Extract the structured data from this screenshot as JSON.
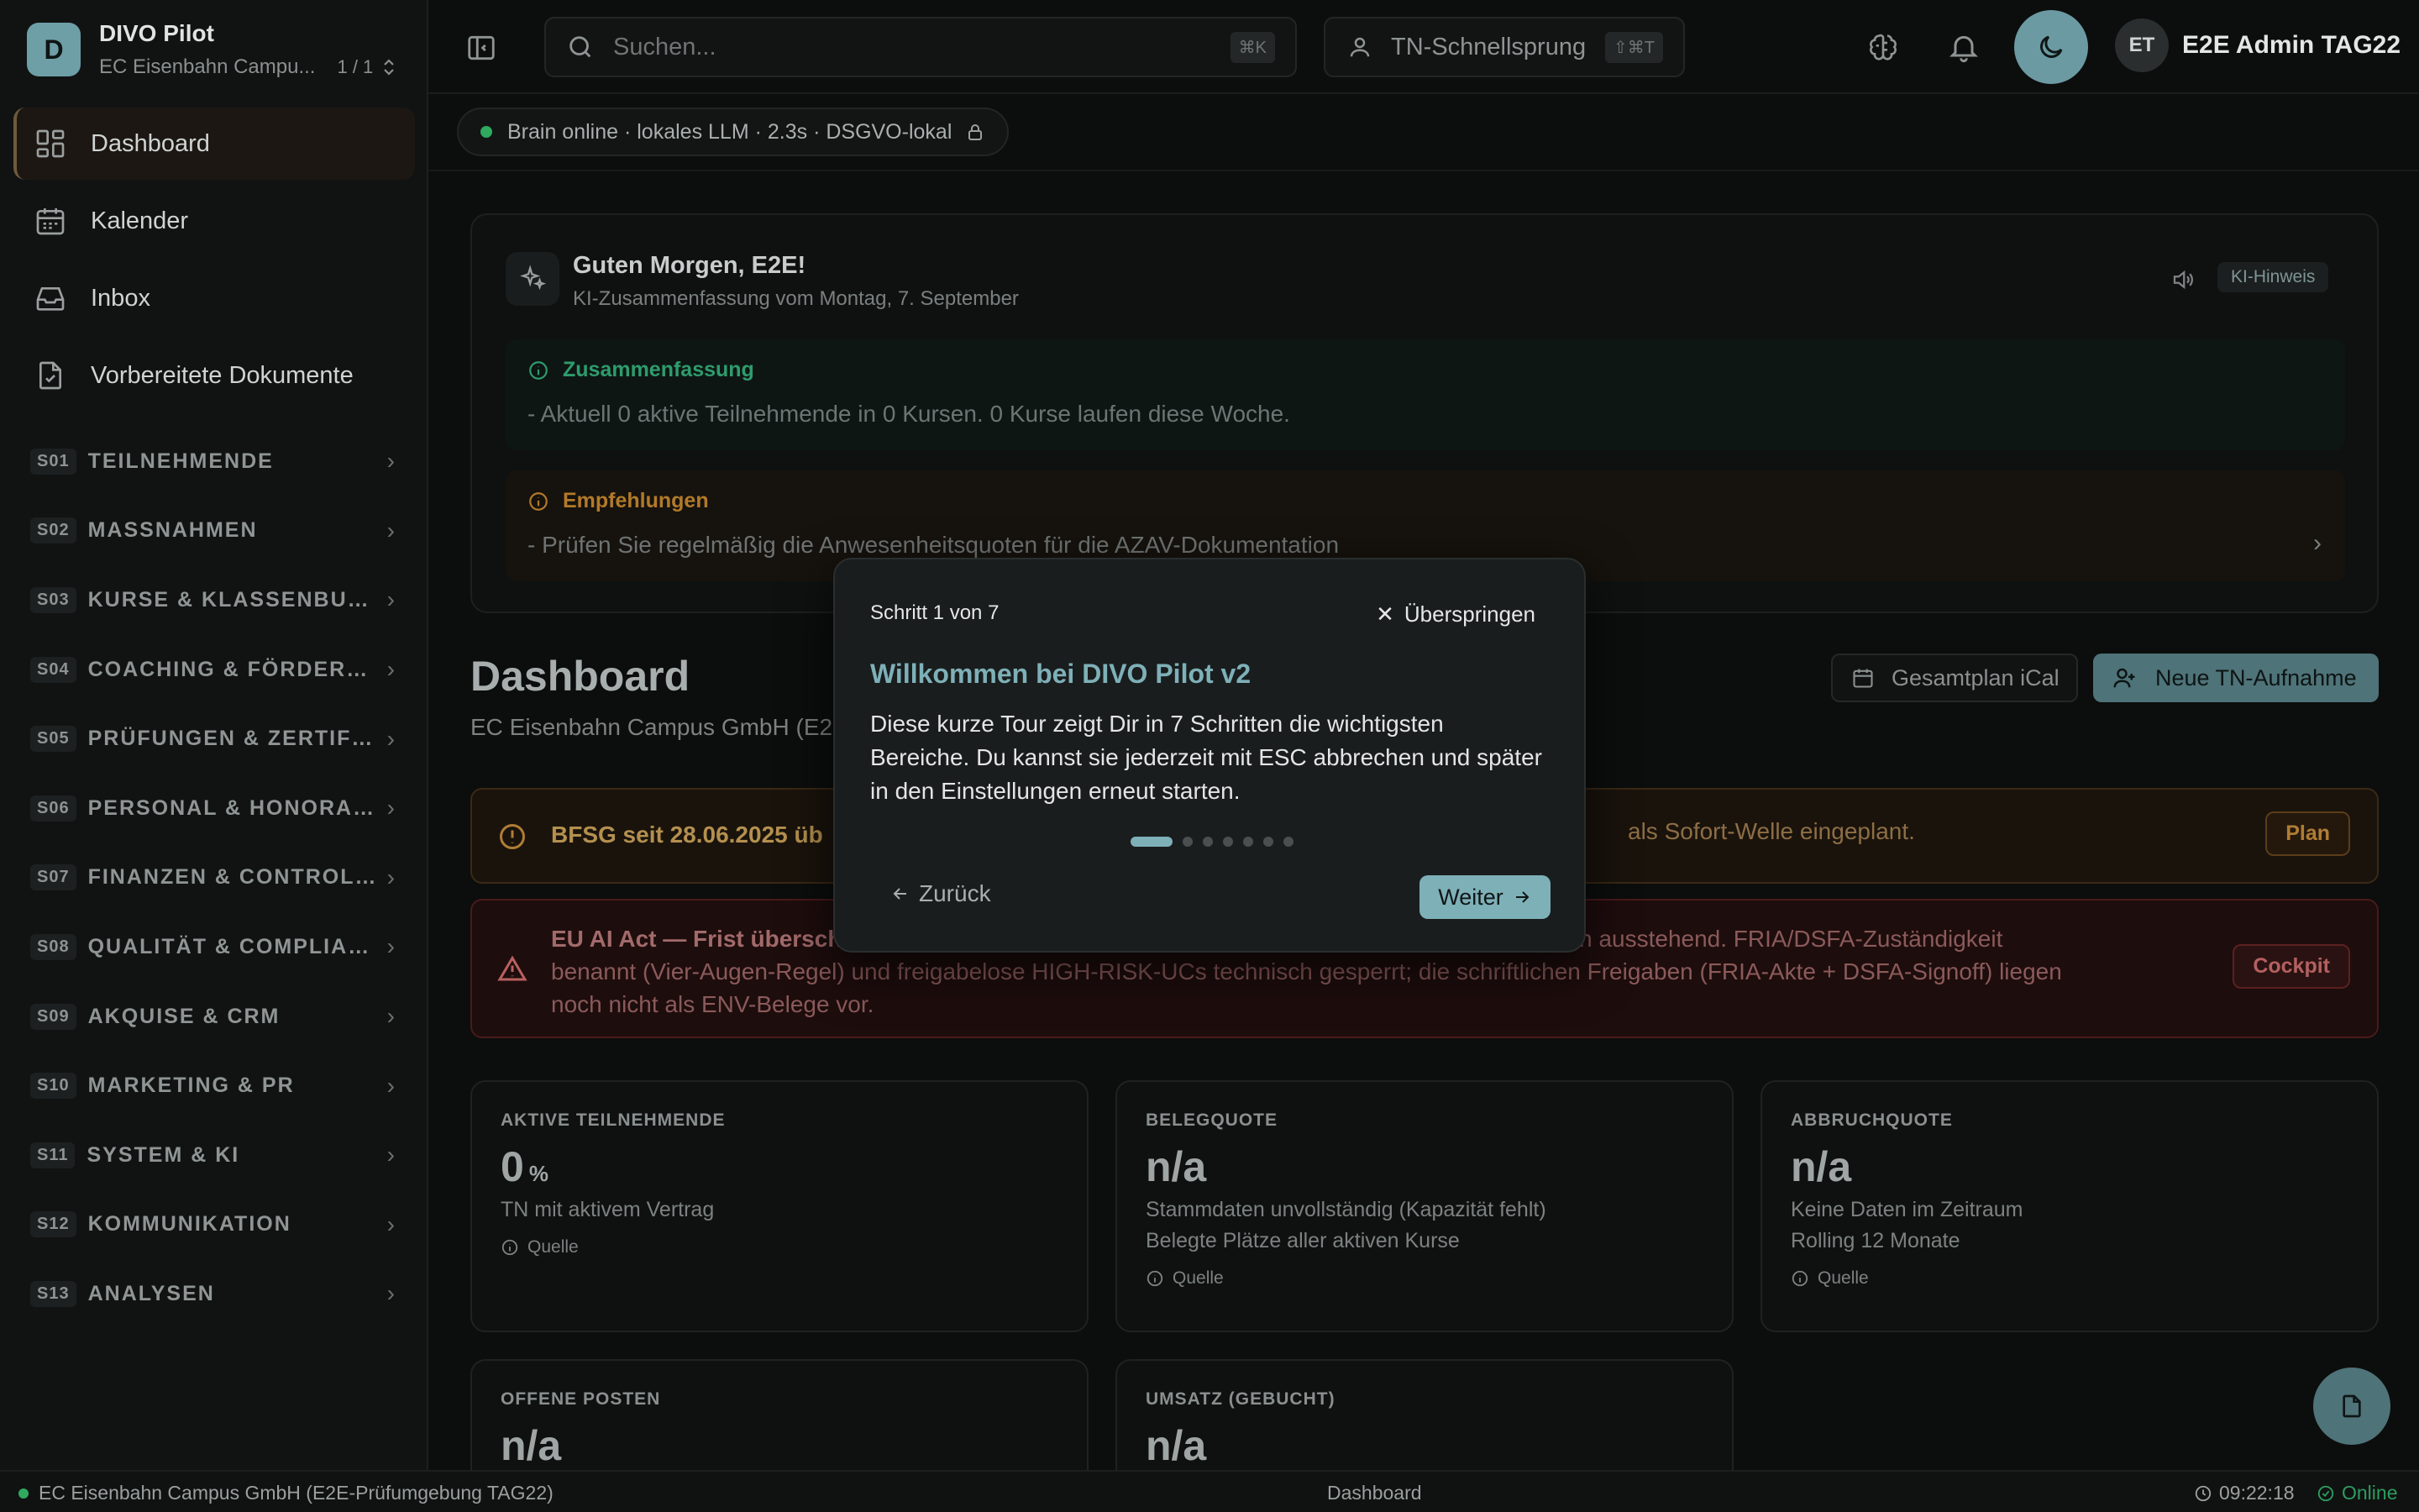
{
  "brand": {
    "logo_letter": "D",
    "title": "DIVO Pilot",
    "org": "EC Eisenbahn Campu...",
    "count": "1 / 1"
  },
  "nav": [
    {
      "label": "Dashboard",
      "icon": "grid-icon"
    },
    {
      "label": "Kalender",
      "icon": "calendar-icon"
    },
    {
      "label": "Inbox",
      "icon": "inbox-icon"
    },
    {
      "label": "Vorbereitete Dokumente",
      "icon": "document-check-icon"
    }
  ],
  "sections": [
    {
      "code": "S01",
      "label": "TEILNEHMENDE"
    },
    {
      "code": "S02",
      "label": "MASSNAHMEN"
    },
    {
      "code": "S03",
      "label": "KURSE & KLASSENBUCH"
    },
    {
      "code": "S04",
      "label": "COACHING & FÖRDERUNG"
    },
    {
      "code": "S05",
      "label": "PRÜFUNGEN & ZERTIFIK..."
    },
    {
      "code": "S06",
      "label": "PERSONAL & HONORAR..."
    },
    {
      "code": "S07",
      "label": "FINANZEN & CONTROLLI..."
    },
    {
      "code": "S08",
      "label": "QUALITÄT & COMPLIANCE"
    },
    {
      "code": "S09",
      "label": "AKQUISE & CRM"
    },
    {
      "code": "S10",
      "label": "MARKETING & PR"
    },
    {
      "code": "S11",
      "label": "SYSTEM & KI"
    },
    {
      "code": "S12",
      "label": "KOMMUNIKATION"
    },
    {
      "code": "S13",
      "label": "ANALYSEN"
    }
  ],
  "topbar": {
    "search_placeholder": "Suchen...",
    "search_kbd": "⌘K",
    "quickjump_label": "TN-Schnellsprung",
    "quickjump_kbd": "⇧⌘T",
    "user_initials": "ET",
    "user_name": "E2E Admin TAG22"
  },
  "brain": {
    "status": "Brain online · lokales LLM · 2.3s · DSGVO-lokal"
  },
  "ki": {
    "greeting": "Guten Morgen, E2E!",
    "subtitle": "KI-Zusammenfassung vom Montag, 7. September",
    "hint": "KI-Hinweis",
    "summary_title": "Zusammenfassung",
    "summary_line": "-  Aktuell 0 aktive Teilnehmende in 0 Kursen. 0 Kurse laufen diese Woche.",
    "recs_title": "Empfehlungen",
    "recs_line": "-  Prüfen Sie regelmäßig die Anwesenheitsquoten für die AZAV-Dokumentation"
  },
  "dashboard": {
    "title": "Dashboard",
    "subtitle": "EC Eisenbahn Campus GmbH (E2",
    "btn_ical": "Gesamtplan iCal",
    "btn_new": "Neue TN-Aufnahme"
  },
  "alerts": {
    "bfsg_bold": "BFSG seit 28.06.2025 üb",
    "bfsg_tail": "als Sofort-Welle eingeplant.",
    "bfsg_btn": "Plan",
    "euai_bold": "EU AI Act — Frist übersch",
    "euai_line1_tail": "eführt, Freigaben ausstehend. FRIA/DSFA-Zuständigkeit",
    "euai_line2": "benannt (Vier-Augen-Regel) und freigabelose HIGH-RISK-UCs technisch gesperrt; die schriftlichen Freigaben (FRIA-Akte + DSFA-Signoff) liegen",
    "euai_line3": "noch nicht als ENV-Belege vor.",
    "euai_btn": "Cockpit"
  },
  "kpis": [
    {
      "label": "AKTIVE TEILNEHMENDE",
      "value": "0",
      "unit": "%",
      "lines": [
        "TN mit aktivem Vertrag"
      ],
      "source": "Quelle"
    },
    {
      "label": "BELEGQUOTE",
      "value": "n/a",
      "unit": "",
      "lines": [
        "Stammdaten unvollständig (Kapazität fehlt)",
        "Belegte Plätze aller aktiven Kurse"
      ],
      "source": "Quelle"
    },
    {
      "label": "ABBRUCHQUOTE",
      "value": "n/a",
      "unit": "",
      "lines": [
        "Keine Daten im Zeitraum",
        "Rolling 12 Monate"
      ],
      "source": "Quelle"
    },
    {
      "label": "OFFENE POSTEN",
      "value": "n/a",
      "unit": "",
      "lines": [],
      "source": ""
    },
    {
      "label": "UMSATZ (GEBUCHT)",
      "value": "n/a",
      "unit": "",
      "lines": [],
      "source": ""
    }
  ],
  "statusbar": {
    "org": "EC Eisenbahn Campus GmbH (E2E-Prüfumgebung TAG22)",
    "page": "Dashboard",
    "time": "09:22:18",
    "online": "Online"
  },
  "tour": {
    "step": "Schritt 1 von 7",
    "skip": "Überspringen",
    "title": "Willkommen bei DIVO Pilot v2",
    "body": "Diese kurze Tour zeigt Dir in 7 Schritten die wichtigsten Bereiche. Du kannst sie jederzeit mit ESC abbrechen und später in den Einstellungen erneut starten.",
    "back": "Zurück",
    "next": "Weiter",
    "total_steps": 7,
    "current_step": 1
  },
  "colors": {
    "accent": "#7eb0b8",
    "accent_dark": "#4e7378",
    "online": "#2faa5e",
    "warn": "#b07d35",
    "error": "#b96060"
  }
}
